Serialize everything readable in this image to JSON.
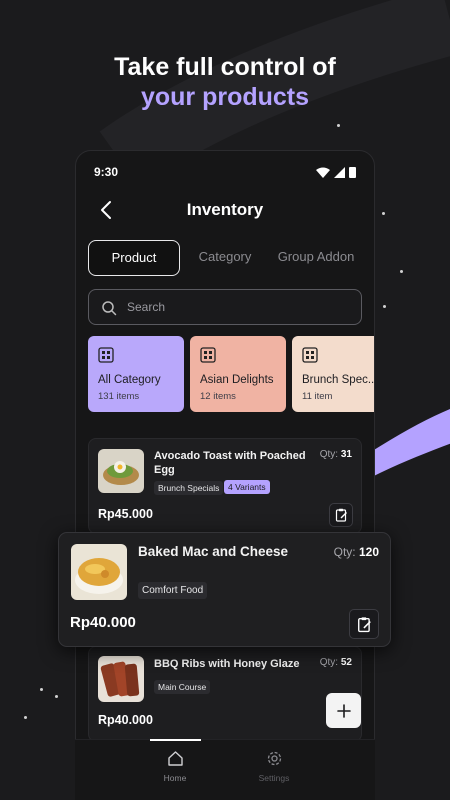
{
  "promo": {
    "line1": "Take full control of",
    "line2": "your products",
    "accent_color": "#b4a2ff"
  },
  "status_bar": {
    "time": "9:30",
    "icons": [
      "wifi-icon",
      "signal-icon",
      "battery-icon"
    ]
  },
  "header": {
    "title": "Inventory",
    "back_icon": "chevron-left-icon"
  },
  "tabs": [
    {
      "label": "Product",
      "active": true
    },
    {
      "label": "Category",
      "active": false
    },
    {
      "label": "Group Addon",
      "active": false
    }
  ],
  "search": {
    "placeholder": "Search",
    "icon": "search-icon"
  },
  "categories": [
    {
      "name": "All Category",
      "count": "131 items",
      "color": "#b9a8fb",
      "icon": "grid-icon"
    },
    {
      "name": "Asian Delights",
      "count": "12 items",
      "color": "#f0b3a3",
      "icon": "grid-icon"
    },
    {
      "name": "Brunch Spec...",
      "count": "11 item",
      "color": "#f3dccc",
      "icon": "grid-icon"
    }
  ],
  "products": [
    {
      "name_line1": "Avocado Toast with Poached",
      "name_line2": "Egg",
      "qty_label": "Qty:",
      "qty": "31",
      "tag": "Brunch Specials",
      "variant": "4 Variants",
      "price": "Rp45.000"
    },
    {
      "name_line1": "Baked Mac and Cheese",
      "qty_label": "Qty:",
      "qty": "120",
      "tag": "Comfort Food",
      "price": "Rp40.000"
    },
    {
      "name_line1": "BBQ Ribs with Honey Glaze",
      "qty_label": "Qty:",
      "qty": "52",
      "tag": "Main Course",
      "price": "Rp40.000"
    }
  ],
  "fab": {
    "icon": "plus-icon"
  },
  "bottom_nav": [
    {
      "label": "Home",
      "icon": "home-icon",
      "active": true
    },
    {
      "label": "Settings",
      "icon": "gear-icon",
      "active": false
    }
  ]
}
